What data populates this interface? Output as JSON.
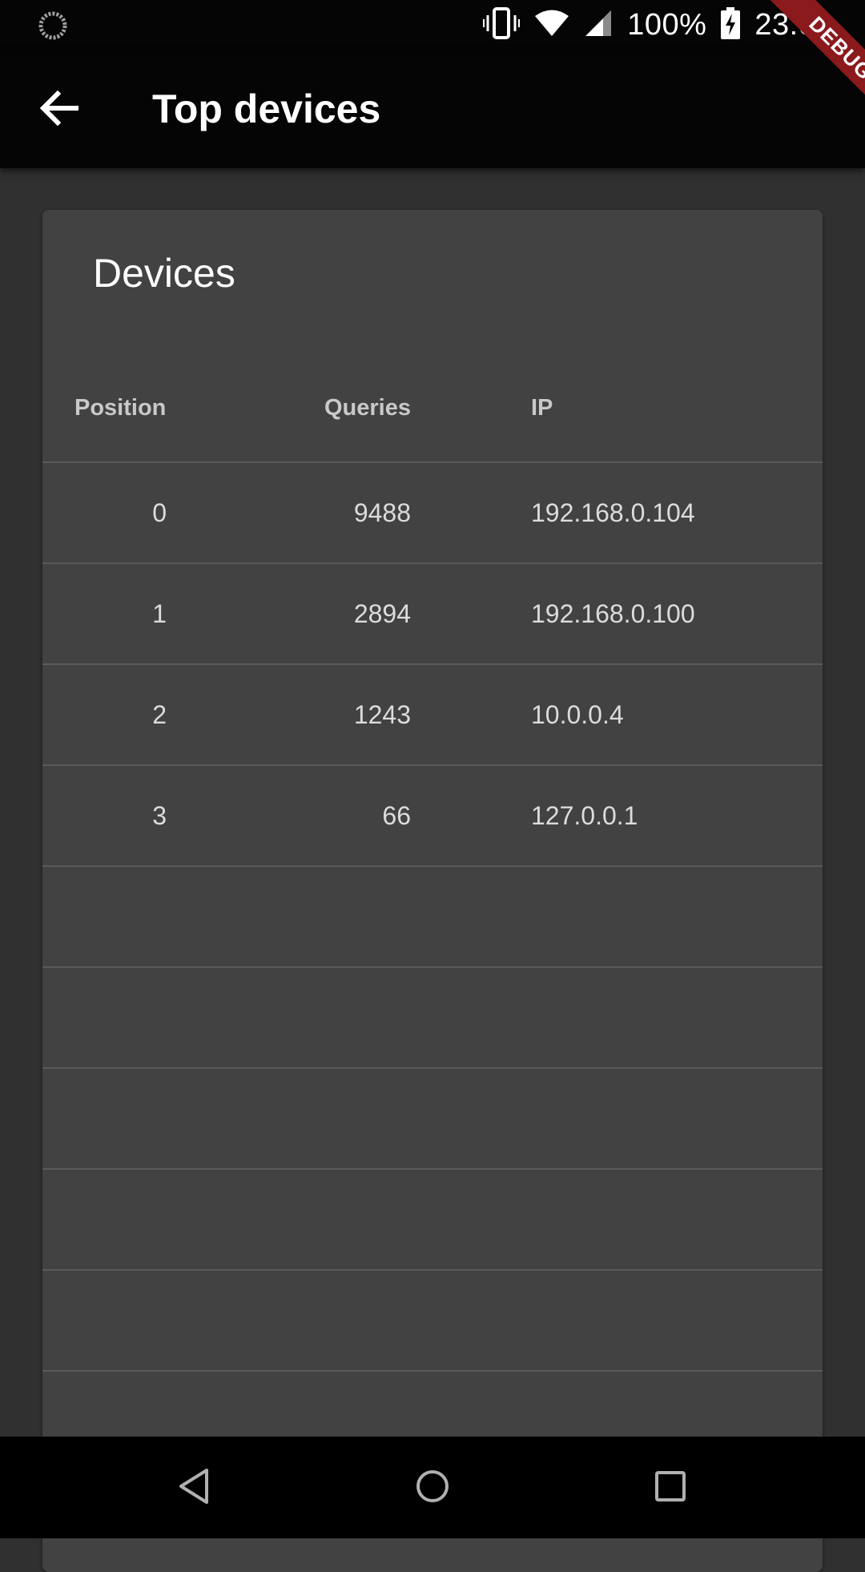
{
  "status_bar": {
    "battery": "100%",
    "time": "23:02",
    "icons": [
      "sync-icon",
      "vibrate-icon",
      "wifi-icon",
      "signal-icon",
      "battery-charging-icon"
    ]
  },
  "debug_banner": "DEBUG",
  "app_bar": {
    "title": "Top devices",
    "back_icon": "arrow-back-icon"
  },
  "card": {
    "title": "Devices",
    "columns": {
      "position": "Position",
      "queries": "Queries",
      "ip": "IP"
    },
    "rows": [
      {
        "position": "0",
        "queries": "9488",
        "ip": "192.168.0.104"
      },
      {
        "position": "1",
        "queries": "2894",
        "ip": "192.168.0.100"
      },
      {
        "position": "2",
        "queries": "1243",
        "ip": "10.0.0.4"
      },
      {
        "position": "3",
        "queries": "66",
        "ip": "127.0.0.1"
      },
      {
        "position": "",
        "queries": "",
        "ip": ""
      },
      {
        "position": "",
        "queries": "",
        "ip": ""
      },
      {
        "position": "",
        "queries": "",
        "ip": ""
      },
      {
        "position": "",
        "queries": "",
        "ip": ""
      },
      {
        "position": "",
        "queries": "",
        "ip": ""
      },
      {
        "position": "",
        "queries": "",
        "ip": ""
      }
    ]
  },
  "nav_bar": {
    "icons": [
      "nav-back-icon",
      "nav-home-icon",
      "nav-recents-icon"
    ]
  },
  "colors": {
    "background": "#303030",
    "card": "#424242",
    "app_bar": "#050505",
    "debug": "#8b1a1d"
  }
}
